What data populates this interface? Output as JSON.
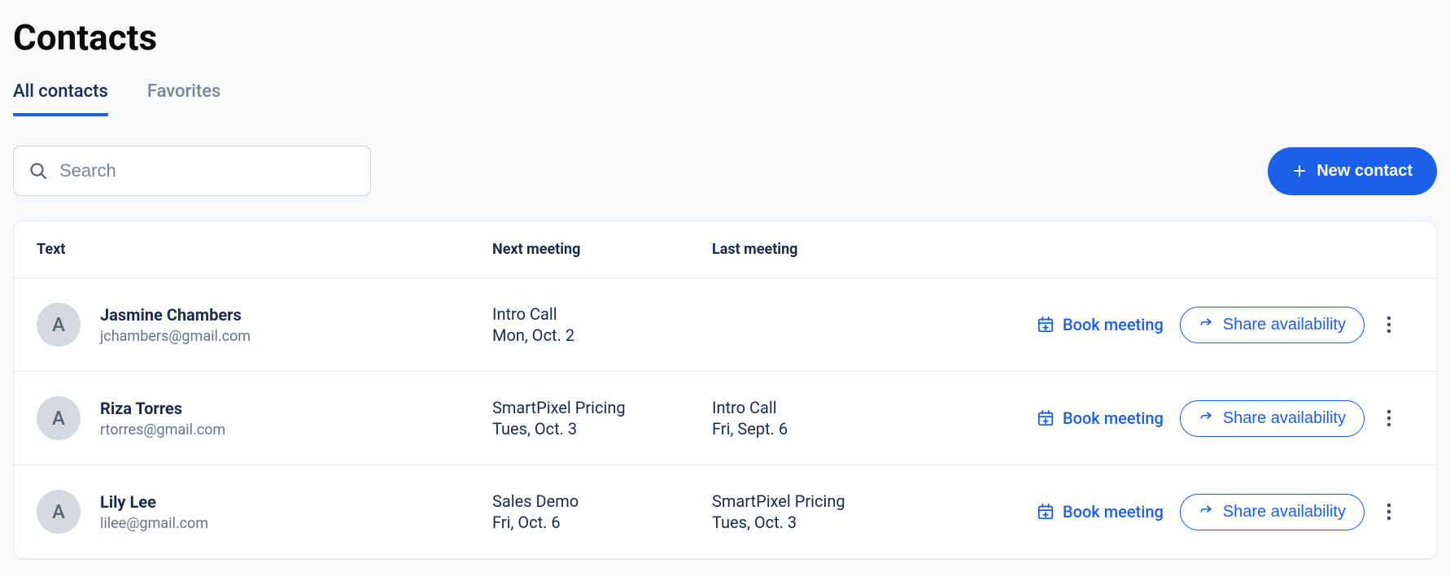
{
  "header": {
    "title": "Contacts"
  },
  "tabs": {
    "all": "All contacts",
    "favorites": "Favorites"
  },
  "search": {
    "placeholder": "Search"
  },
  "buttons": {
    "new_contact": "New contact",
    "book_meeting": "Book meeting",
    "share_availability": "Share availability"
  },
  "table": {
    "headers": {
      "text": "Text",
      "next_meeting": "Next meeting",
      "last_meeting": "Last meeting"
    },
    "rows": [
      {
        "avatar_initial": "A",
        "name": "Jasmine Chambers",
        "email": "jchambers@gmail.com",
        "next_meeting_title": "Intro Call",
        "next_meeting_date": "Mon, Oct. 2",
        "last_meeting_title": "",
        "last_meeting_date": ""
      },
      {
        "avatar_initial": "A",
        "name": "Riza Torres",
        "email": "rtorres@gmail.com",
        "next_meeting_title": "SmartPixel Pricing",
        "next_meeting_date": "Tues, Oct. 3",
        "last_meeting_title": "Intro Call",
        "last_meeting_date": "Fri, Sept. 6"
      },
      {
        "avatar_initial": "A",
        "name": "Lily Lee",
        "email": "lilee@gmail.com",
        "next_meeting_title": "Sales Demo",
        "next_meeting_date": "Fri, Oct. 6",
        "last_meeting_title": "SmartPixel Pricing",
        "last_meeting_date": "Tues, Oct. 3"
      }
    ]
  }
}
